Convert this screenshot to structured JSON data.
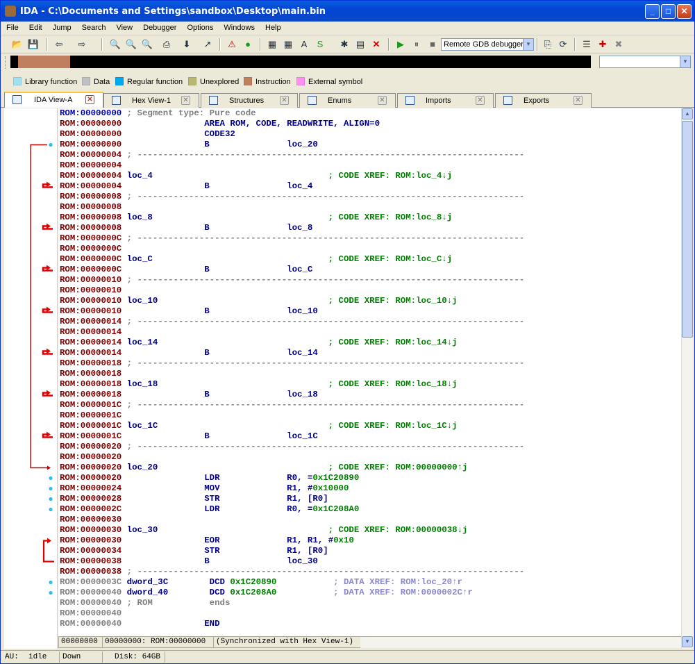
{
  "window": {
    "title": "IDA - C:\\Documents and Settings\\sandbox\\Desktop\\main.bin"
  },
  "menu": [
    "File",
    "Edit",
    "Jump",
    "Search",
    "View",
    "Debugger",
    "Options",
    "Windows",
    "Help"
  ],
  "toolbar": {
    "debugger_select": "Remote GDB debugger"
  },
  "legend": [
    {
      "label": "Library function",
      "color": "#a0e0f0"
    },
    {
      "label": "Data",
      "color": "#c0c0c0"
    },
    {
      "label": "Regular function",
      "color": "#00a8f0"
    },
    {
      "label": "Unexplored",
      "color": "#b8b870"
    },
    {
      "label": "Instruction",
      "color": "#c08060"
    },
    {
      "label": "External symbol",
      "color": "#ff90f0"
    }
  ],
  "tabs": [
    {
      "label": "IDA View-A",
      "icon": "disassembly-icon",
      "active": true
    },
    {
      "label": "Hex View-1",
      "icon": "hex-icon",
      "active": false
    },
    {
      "label": "Structures",
      "icon": "structures-icon",
      "active": false
    },
    {
      "label": "Enums",
      "icon": "enums-icon",
      "active": false
    },
    {
      "label": "Imports",
      "icon": "imports-icon",
      "active": false
    },
    {
      "label": "Exports",
      "icon": "exports-icon",
      "active": false
    }
  ],
  "code_lines": [
    {
      "addr": "ROM:00000000",
      "text": " ; Segment type: Pure code",
      "kind": "cmt",
      "addrclass": "blue"
    },
    {
      "addr": "ROM:00000000",
      "text": "                AREA ROM, CODE, READWRITE, ALIGN=0",
      "kind": "nm"
    },
    {
      "addr": "ROM:00000000",
      "text": "                CODE32",
      "kind": "nm"
    },
    {
      "addr": "ROM:00000000",
      "text": "                B               loc_20",
      "kind": "nm"
    },
    {
      "addr": "ROM:00000004",
      "text": " ; ---------------------------------------------------------------------------",
      "kind": "cmt"
    },
    {
      "addr": "ROM:00000004",
      "text": "",
      "kind": "nm"
    },
    {
      "addr": "ROM:00000004",
      "text": " loc_4",
      "xref": "                                  ; CODE XREF: ROM:loc_4↓j",
      "kind": "lbl"
    },
    {
      "addr": "ROM:00000004",
      "text": "                B               loc_4",
      "kind": "nm"
    },
    {
      "addr": "ROM:00000008",
      "text": " ; ---------------------------------------------------------------------------",
      "kind": "cmt"
    },
    {
      "addr": "ROM:00000008",
      "text": "",
      "kind": "nm"
    },
    {
      "addr": "ROM:00000008",
      "text": " loc_8",
      "xref": "                                  ; CODE XREF: ROM:loc_8↓j",
      "kind": "lbl"
    },
    {
      "addr": "ROM:00000008",
      "text": "                B               loc_8",
      "kind": "nm"
    },
    {
      "addr": "ROM:0000000C",
      "text": " ; ---------------------------------------------------------------------------",
      "kind": "cmt"
    },
    {
      "addr": "ROM:0000000C",
      "text": "",
      "kind": "nm"
    },
    {
      "addr": "ROM:0000000C",
      "text": " loc_C",
      "xref": "                                  ; CODE XREF: ROM:loc_C↓j",
      "kind": "lbl"
    },
    {
      "addr": "ROM:0000000C",
      "text": "                B               loc_C",
      "kind": "nm"
    },
    {
      "addr": "ROM:00000010",
      "text": " ; ---------------------------------------------------------------------------",
      "kind": "cmt"
    },
    {
      "addr": "ROM:00000010",
      "text": "",
      "kind": "nm"
    },
    {
      "addr": "ROM:00000010",
      "text": " loc_10",
      "xref": "                                 ; CODE XREF: ROM:loc_10↓j",
      "kind": "lbl"
    },
    {
      "addr": "ROM:00000010",
      "text": "                B               loc_10",
      "kind": "nm"
    },
    {
      "addr": "ROM:00000014",
      "text": " ; ---------------------------------------------------------------------------",
      "kind": "cmt"
    },
    {
      "addr": "ROM:00000014",
      "text": "",
      "kind": "nm"
    },
    {
      "addr": "ROM:00000014",
      "text": " loc_14",
      "xref": "                                 ; CODE XREF: ROM:loc_14↓j",
      "kind": "lbl"
    },
    {
      "addr": "ROM:00000014",
      "text": "                B               loc_14",
      "kind": "nm"
    },
    {
      "addr": "ROM:00000018",
      "text": " ; ---------------------------------------------------------------------------",
      "kind": "cmt"
    },
    {
      "addr": "ROM:00000018",
      "text": "",
      "kind": "nm"
    },
    {
      "addr": "ROM:00000018",
      "text": " loc_18",
      "xref": "                                 ; CODE XREF: ROM:loc_18↓j",
      "kind": "lbl"
    },
    {
      "addr": "ROM:00000018",
      "text": "                B               loc_18",
      "kind": "nm"
    },
    {
      "addr": "ROM:0000001C",
      "text": " ; ---------------------------------------------------------------------------",
      "kind": "cmt"
    },
    {
      "addr": "ROM:0000001C",
      "text": "",
      "kind": "nm"
    },
    {
      "addr": "ROM:0000001C",
      "text": " loc_1C",
      "xref": "                                 ; CODE XREF: ROM:loc_1C↓j",
      "kind": "lbl"
    },
    {
      "addr": "ROM:0000001C",
      "text": "                B               loc_1C",
      "kind": "nm"
    },
    {
      "addr": "ROM:00000020",
      "text": " ; ---------------------------------------------------------------------------",
      "kind": "cmt"
    },
    {
      "addr": "ROM:00000020",
      "text": "",
      "kind": "nm"
    },
    {
      "addr": "ROM:00000020",
      "text": " loc_20",
      "xref": "                                 ; CODE XREF: ROM:00000000↑j",
      "kind": "lbl"
    },
    {
      "addr": "ROM:00000020",
      "text": "                LDR             R0, =",
      "num": "0x1C20890",
      "kind": "ins"
    },
    {
      "addr": "ROM:00000024",
      "text": "                MOV             R1, #",
      "num": "0x10000",
      "kind": "ins"
    },
    {
      "addr": "ROM:00000028",
      "text": "                STR             R1, [R0]",
      "kind": "nm"
    },
    {
      "addr": "ROM:0000002C",
      "text": "                LDR             R0, =",
      "num": "0x1C208A0",
      "kind": "ins"
    },
    {
      "addr": "ROM:00000030",
      "text": "",
      "kind": "nm"
    },
    {
      "addr": "ROM:00000030",
      "text": " loc_30",
      "xref": "                                 ; CODE XREF: ROM:00000038↓j",
      "kind": "lbl"
    },
    {
      "addr": "ROM:00000030",
      "text": "                EOR             R1, R1, #",
      "num": "0x10",
      "kind": "ins"
    },
    {
      "addr": "ROM:00000034",
      "text": "                STR             R1, [R0]",
      "kind": "nm"
    },
    {
      "addr": "ROM:00000038",
      "text": "                B               loc_30",
      "kind": "nm"
    },
    {
      "addr": "ROM:00000038",
      "text": " ; ---------------------------------------------------------------------------",
      "kind": "cmt"
    },
    {
      "addr": "ROM:0000003C",
      "text": " dword_3C        DCD ",
      "num": "0x1C20890",
      "xref": "           ; DATA XREF: ROM:loc_20↑r",
      "kind": "data",
      "addrclass": "gray"
    },
    {
      "addr": "ROM:00000040",
      "text": " dword_40        DCD ",
      "num": "0x1C208A0",
      "xref": "           ; DATA XREF: ROM:0000002C↑r",
      "kind": "data",
      "addrclass": "gray"
    },
    {
      "addr": "ROM:00000040",
      "text": " ; ROM           ends",
      "kind": "cmt",
      "addrclass": "gray"
    },
    {
      "addr": "ROM:00000040",
      "text": "",
      "kind": "nm",
      "addrclass": "gray"
    },
    {
      "addr": "ROM:00000040",
      "text": "                END",
      "kind": "nm",
      "addrclass": "gray"
    }
  ],
  "code_status": {
    "offset": "00000000",
    "location": "00000000: ROM:00000000",
    "sync": "(Synchronized with Hex View-1)"
  },
  "statusbar": {
    "au_label": "AU:",
    "au_state": "idle",
    "direction": "Down",
    "disk": "Disk: 64GB"
  }
}
